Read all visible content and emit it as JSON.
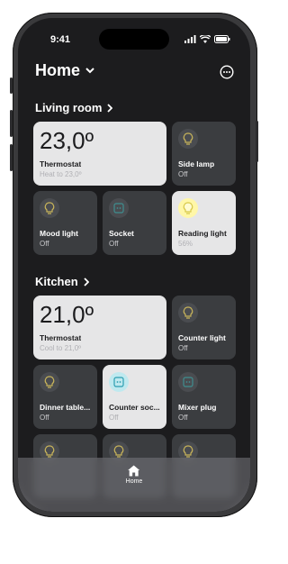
{
  "status": {
    "time": "9:41"
  },
  "header": {
    "title": "Home"
  },
  "sections": {
    "living": {
      "title": "Living room"
    },
    "kitchen": {
      "title": "Kitchen"
    }
  },
  "living": {
    "thermostat": {
      "temp": "23,0º",
      "label": "Thermostat",
      "sub": "Heat to 23,0º"
    },
    "side_lamp": {
      "label": "Side lamp",
      "sub": "Off"
    },
    "mood_light": {
      "label": "Mood light",
      "sub": "Off"
    },
    "socket": {
      "label": "Socket",
      "sub": "Off"
    },
    "reading_light": {
      "label": "Reading light",
      "sub": "56%"
    }
  },
  "kitchen": {
    "thermostat": {
      "temp": "21,0º",
      "label": "Thermostat",
      "sub": "Cool to 21,0º"
    },
    "counter_light": {
      "label": "Counter light",
      "sub": "Off"
    },
    "dinner_table": {
      "label": "Dinner table...",
      "sub": "Off"
    },
    "counter_socket": {
      "label": "Counter soc...",
      "sub": "Off"
    },
    "mixer_plug": {
      "label": "Mixer plug",
      "sub": "Off"
    }
  },
  "tabbar": {
    "home_label": "Home"
  },
  "colors": {
    "bulb_off": "#c8b45a",
    "bulb_on": "#fff7a8",
    "socket_on": "#5ec8d8",
    "socket_off": "#3f8e8f"
  }
}
